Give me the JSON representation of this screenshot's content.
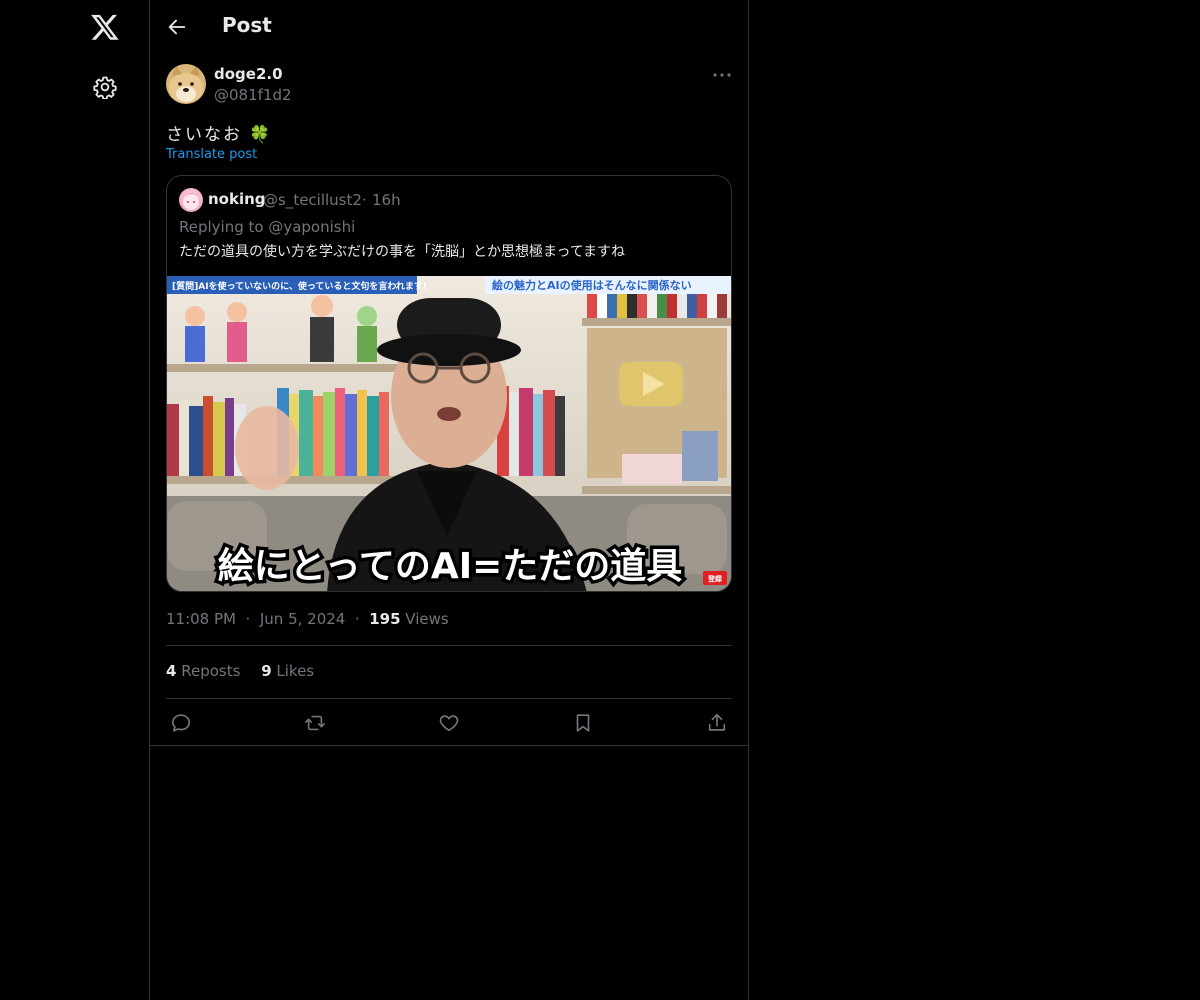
{
  "header": {
    "title": "Post"
  },
  "post": {
    "author_name": "doge2.0",
    "author_handle": "@081f1d2",
    "text": "さいなお",
    "emoji": "🍀",
    "translate_label": "Translate post",
    "time": "11:08 PM",
    "date": "Jun 5, 2024",
    "views_count": "195",
    "views_label": "Views",
    "reposts_count": "4",
    "reposts_label": "Reposts",
    "likes_count": "9",
    "likes_label": "Likes"
  },
  "quote": {
    "author_name": "noking",
    "author_handle": "@s_tecillust2",
    "time": "16h",
    "replying_to": "Replying to @yaponishi",
    "text": "ただの道具の使い方を学ぶだけの事を「洗脳」とか思想極まってますね",
    "media": {
      "banner_left": "[質問]AIを使っていないのに、使っていると文句を言われます!",
      "banner_right": "絵の魅力とAIの使用はそんなに関係ない",
      "caption": "絵にとってのAI=ただの道具",
      "badge": "登録"
    }
  },
  "icons": {
    "logo": "x-logo-icon",
    "settings": "gear-icon",
    "back": "back-arrow-icon",
    "more": "more-dots-icon",
    "reply": "reply-icon",
    "repost": "repost-icon",
    "like": "heart-icon",
    "bookmark": "bookmark-icon",
    "share": "share-icon"
  },
  "colors": {
    "background": "#000000",
    "text": "#e7e9ea",
    "muted": "#71767b",
    "accent": "#1d9bf0",
    "border": "#2f3336"
  }
}
